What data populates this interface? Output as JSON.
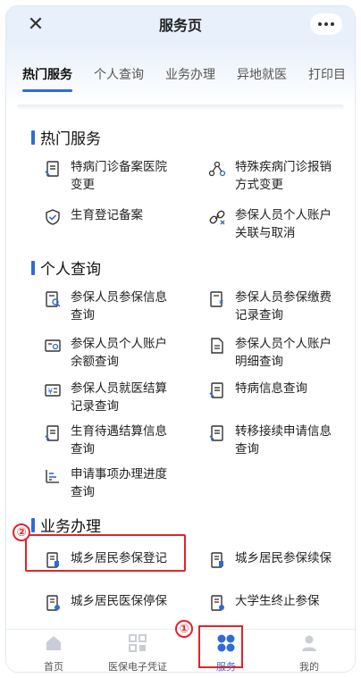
{
  "header": {
    "title": "服务页",
    "close": "✕"
  },
  "tabs": [
    "热门服务",
    "个人查询",
    "业务办理",
    "异地就医",
    "打印目"
  ],
  "sections": {
    "hot": {
      "title": "热门服务",
      "items": [
        {
          "line1": "特病门诊备案医院",
          "line2": "变更",
          "icon": "doc-edit-icon"
        },
        {
          "line1": "特殊疾病门诊报销",
          "line2": "方式变更",
          "icon": "molecule-icon"
        },
        {
          "line1": "生育登记备案",
          "line2": "",
          "icon": "shield-check-icon"
        },
        {
          "line1": "参保人员个人账户",
          "line2": "关联与取消",
          "icon": "link-cancel-icon"
        }
      ]
    },
    "personal": {
      "title": "个人查询",
      "items": [
        {
          "line1": "参保人员参保信息",
          "line2": "查询",
          "icon": "doc-search-icon"
        },
        {
          "line1": "参保人员参保缴费",
          "line2": "记录查询",
          "icon": "doc-money-icon"
        },
        {
          "line1": "参保人员个人账户",
          "line2": "余额查询",
          "icon": "card-search-icon"
        },
        {
          "line1": "参保人员个人账户",
          "line2": "明细查询",
          "icon": "document-icon"
        },
        {
          "line1": "参保人员就医结算",
          "line2": "记录查询",
          "icon": "yen-card-icon"
        },
        {
          "line1": "特病信息查询",
          "line2": "",
          "icon": "doc-edit-icon"
        },
        {
          "line1": "生育待遇结算信息",
          "line2": "查询",
          "icon": "doc-edit-icon"
        },
        {
          "line1": "转移接续申请信息",
          "line2": "查询",
          "icon": "doc-edit-icon"
        },
        {
          "line1": "申请事项办理进度",
          "line2": "查询",
          "icon": "progress-chart-icon"
        }
      ]
    },
    "business": {
      "title": "业务办理",
      "items": [
        {
          "line1": "城乡居民参保登记",
          "icon": "doc-register-icon"
        },
        {
          "line1": "城乡居民参保续保",
          "icon": "doc-register-icon"
        },
        {
          "line1": "城乡居民医保停保",
          "icon": "doc-stop-icon"
        },
        {
          "line1": "大学生终止参保",
          "icon": "doc-stop-icon"
        }
      ]
    }
  },
  "bottom_nav": [
    {
      "label": "首页",
      "icon": "home-icon"
    },
    {
      "label": "医保电子凭证",
      "icon": "qr-code-icon"
    },
    {
      "label": "服务",
      "icon": "services-icon"
    },
    {
      "label": "我的",
      "icon": "user-icon"
    }
  ],
  "annotations": {
    "badge1": "①",
    "badge2": "②"
  },
  "colors": {
    "accent": "#2f6bd8",
    "highlight": "#e0242b"
  }
}
